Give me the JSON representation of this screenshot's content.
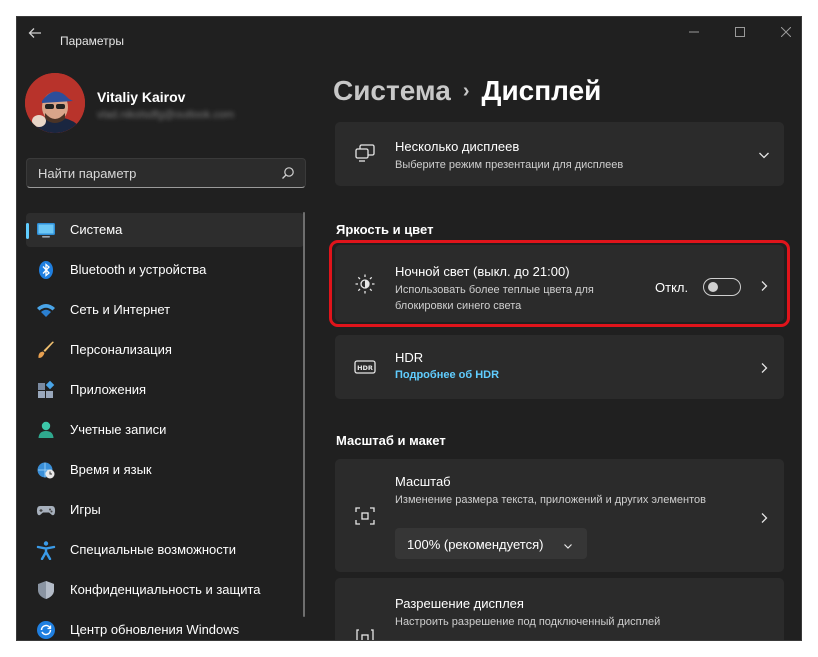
{
  "window": {
    "title": "Параметры",
    "back_icon": "arrow-left-icon",
    "controls": [
      "minimize-icon",
      "maximize-icon",
      "close-icon"
    ]
  },
  "profile": {
    "name": "Vitaliy Kairov",
    "email": "vlad.nikolsdfg@outlook.com"
  },
  "search": {
    "placeholder": "Найти параметр",
    "icon": "search-icon"
  },
  "sidebar": {
    "items": [
      {
        "label": "Система",
        "icon": "system-display-icon",
        "active": true
      },
      {
        "label": "Bluetooth и устройства",
        "icon": "bluetooth-icon"
      },
      {
        "label": "Сеть и Интернет",
        "icon": "wifi-icon"
      },
      {
        "label": "Персонализация",
        "icon": "brush-icon"
      },
      {
        "label": "Приложения",
        "icon": "apps-icon"
      },
      {
        "label": "Учетные записи",
        "icon": "person-icon"
      },
      {
        "label": "Время и язык",
        "icon": "globe-clock-icon"
      },
      {
        "label": "Игры",
        "icon": "gamepad-icon"
      },
      {
        "label": "Специальные возможности",
        "icon": "accessibility-icon"
      },
      {
        "label": "Конфиденциальность и защита",
        "icon": "shield-icon"
      },
      {
        "label": "Центр обновления Windows",
        "icon": "update-icon"
      }
    ]
  },
  "breadcrumb": {
    "parent": "Система",
    "separator": "›",
    "current": "Дисплей"
  },
  "main": {
    "multi_display": {
      "title": "Несколько дисплеев",
      "subtitle": "Выберите режим презентации для дисплеев",
      "icon": "multiple-displays-icon"
    },
    "section_brightness": "Яркость и цвет",
    "night_light": {
      "title": "Ночной свет (выкл. до 21:00)",
      "subtitle_line1": "Использовать более теплые цвета для",
      "subtitle_line2": "блокировки синего света",
      "toggle_label": "Откл.",
      "toggle_on": false,
      "icon": "night-light-icon"
    },
    "hdr": {
      "title": "HDR",
      "link": "Подробнее об HDR",
      "icon": "hdr-icon"
    },
    "section_scale": "Масштаб и макет",
    "scale": {
      "title": "Масштаб",
      "subtitle": "Изменение размера текста, приложений и других элементов",
      "dropdown_value": "100% (рекомендуется)",
      "icon": "scale-icon"
    },
    "resolution": {
      "title": "Разрешение дисплея",
      "subtitle": "Настроить разрешение под подключенный дисплей",
      "icon": "resolution-icon"
    }
  },
  "colors": {
    "accent": "#60cdff",
    "background": "#202020",
    "card": "#2b2b2b",
    "highlight": "#e0141b"
  }
}
